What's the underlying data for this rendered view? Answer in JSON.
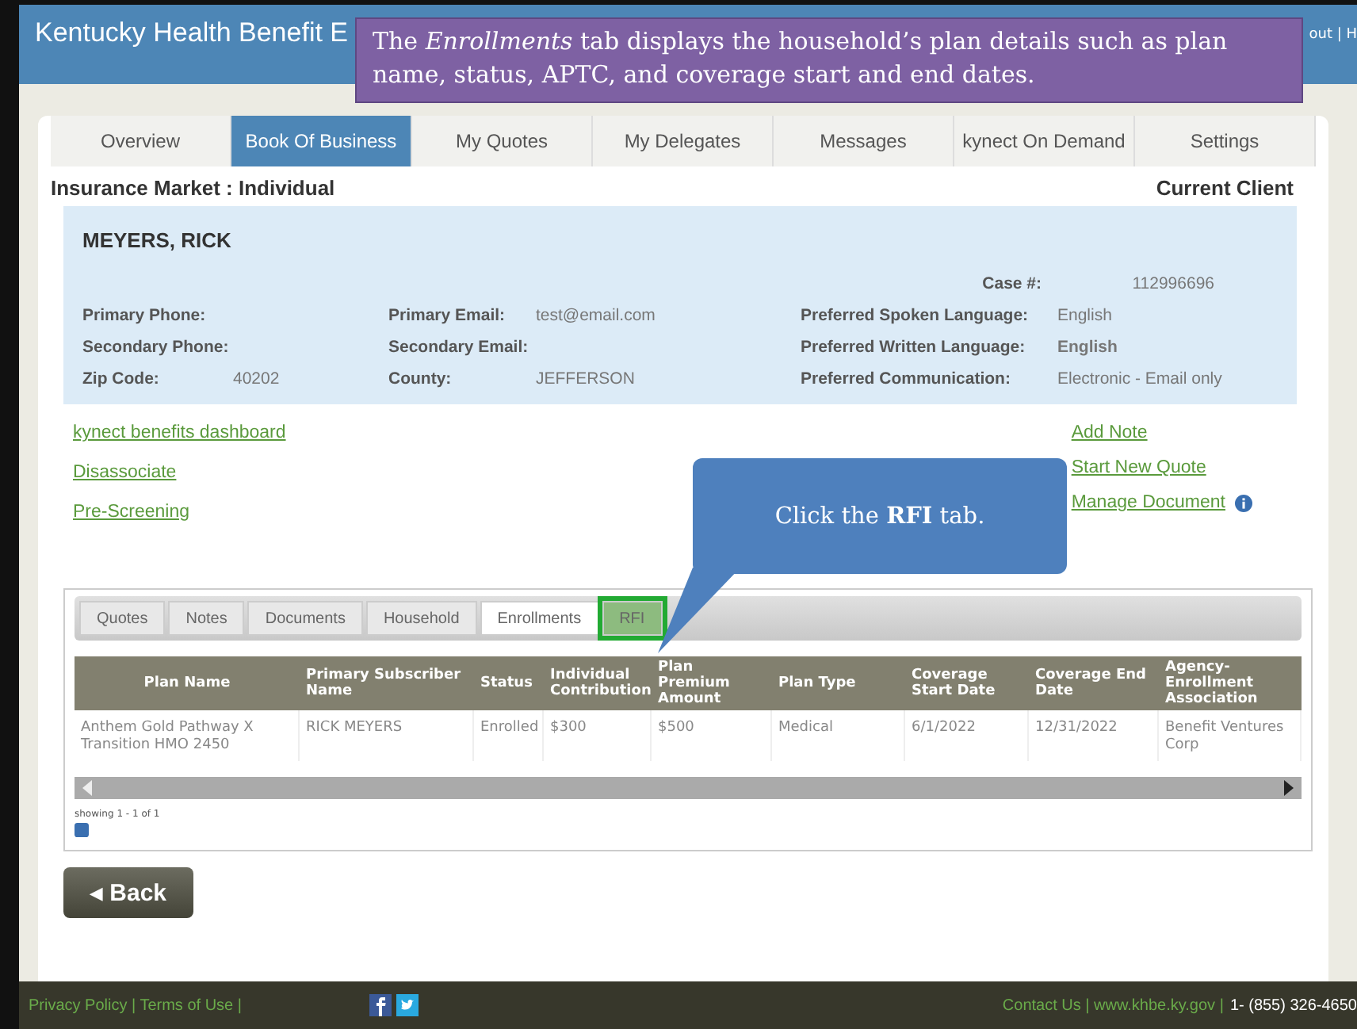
{
  "header": {
    "title": "Kentucky Health Benefit E",
    "corner_text": "out | H"
  },
  "tutorial_callout": {
    "text": "The *Enrollments* tab displays the household’s plan details such as plan name, status, APTC, and coverage start and end dates."
  },
  "tabs": [
    {
      "label": "Overview",
      "selected": false
    },
    {
      "label": "Book Of Business",
      "selected": true
    },
    {
      "label": "My Quotes",
      "selected": false
    },
    {
      "label": "My Delegates",
      "selected": false
    },
    {
      "label": "Messages",
      "selected": false
    },
    {
      "label": "kynect On Demand",
      "selected": false
    },
    {
      "label": "Settings",
      "selected": false
    }
  ],
  "market": "Insurance Market : Individual",
  "client_label": "Current Client",
  "client": {
    "name": "MEYERS, RICK",
    "case_label": "Case #:",
    "case_value": "112996696",
    "fields": [
      {
        "label": "Primary Phone:",
        "label2": "Primary Email:",
        "value2": "test@email.com",
        "label3": "Preferred Spoken Language:",
        "value3": "English"
      },
      {
        "label": "Secondary Phone:",
        "label2": "Secondary Email:",
        "label3": "Preferred Written Language:",
        "value3": "English"
      },
      {
        "label": "Zip Code:",
        "value": "40202",
        "label2": "County:",
        "value2": "JEFFERSON",
        "label3": "Preferred Communication:",
        "value3": "Electronic - Email only"
      }
    ]
  },
  "left_links": [
    "kynect benefits dashboard",
    "Disassociate",
    "Pre-Screening"
  ],
  "right_links": [
    {
      "label": "Add Note",
      "info": false
    },
    {
      "label": "Start New Quote",
      "info": false
    },
    {
      "label": "Manage Document",
      "info": true
    }
  ],
  "step_callout": {
    "text": "Click the **RFI** tab."
  },
  "sub_tabs": [
    {
      "label": "Quotes",
      "selected": false,
      "highlighted": false
    },
    {
      "label": "Notes",
      "selected": false,
      "highlighted": false
    },
    {
      "label": "Documents",
      "selected": false,
      "highlighted": false
    },
    {
      "label": "Household",
      "selected": false,
      "highlighted": false
    },
    {
      "label": "Enrollments",
      "selected": true,
      "highlighted": false
    },
    {
      "label": "RFI",
      "selected": false,
      "highlighted": true
    }
  ],
  "table": {
    "columns": [
      "Plan Name",
      "Primary Subscriber Name",
      "Status",
      "Individual Contribution",
      "Plan Premium Amount",
      "Plan Type",
      "Coverage Start Date",
      "Coverage End Date",
      "Agency-Enrollment Association"
    ],
    "rows": [
      [
        "Anthem Gold Pathway X Transition HMO 2450",
        "RICK MEYERS",
        "Enrolled",
        "$300",
        "$500",
        "Medical",
        "6/1/2022",
        "12/31/2022",
        "Benefit Ventures Corp"
      ]
    ],
    "pager": "showing 1 - 1 of 1"
  },
  "back_button": "◂ Back",
  "footer": {
    "left": "Privacy Policy | Terms of Use |",
    "contact": "Contact Us | www.khbe.ky.gov |",
    "phone": "1- (855) 326-4650"
  }
}
